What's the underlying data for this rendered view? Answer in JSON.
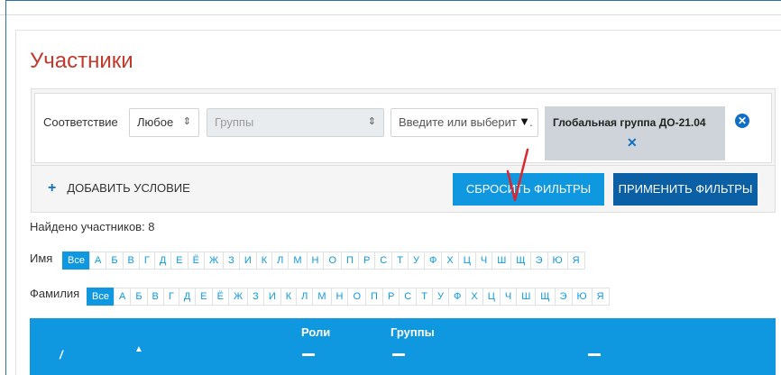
{
  "page": {
    "title": "Участники"
  },
  "filters": {
    "match_label": "Соответствие",
    "match_value": "Любое",
    "match_arrow": "⇕",
    "type_value": "Группы",
    "type_arrow": "⇕",
    "search_placeholder": "Введите или выберите...",
    "dropdown_arrow": "▼",
    "chip_label": "Глобальная группа ДО-21.04",
    "chip_remove": "✕",
    "row_remove": "✕",
    "add_condition_icon": "+",
    "add_condition_label": "ДОБАВИТЬ УСЛОВИЕ",
    "reset_label": "СБРОСИТЬ ФИЛЬТРЫ",
    "apply_label": "ПРИМЕНИТЬ ФИЛЬТРЫ"
  },
  "summary": {
    "found_text": "Найдено участников: 8"
  },
  "initials": {
    "first_name_label": "Имя",
    "last_name_label": "Фамилия",
    "all_label": "Все",
    "letters": [
      "А",
      "Б",
      "В",
      "Г",
      "Д",
      "Е",
      "Ё",
      "Ж",
      "З",
      "И",
      "К",
      "Л",
      "М",
      "Н",
      "О",
      "П",
      "Р",
      "С",
      "Т",
      "У",
      "Ф",
      "Х",
      "Ц",
      "Ч",
      "Ш",
      "Щ",
      "Э",
      "Ю",
      "Я"
    ]
  },
  "table": {
    "slash": "/",
    "sort_icon": "▲",
    "roles_header": "Роли",
    "groups_header": "Группы"
  },
  "colors": {
    "title": "#c0392b",
    "primary": "#0f98e0",
    "primary_dark": "#0b5fa5",
    "annotation": "#e0242b"
  }
}
